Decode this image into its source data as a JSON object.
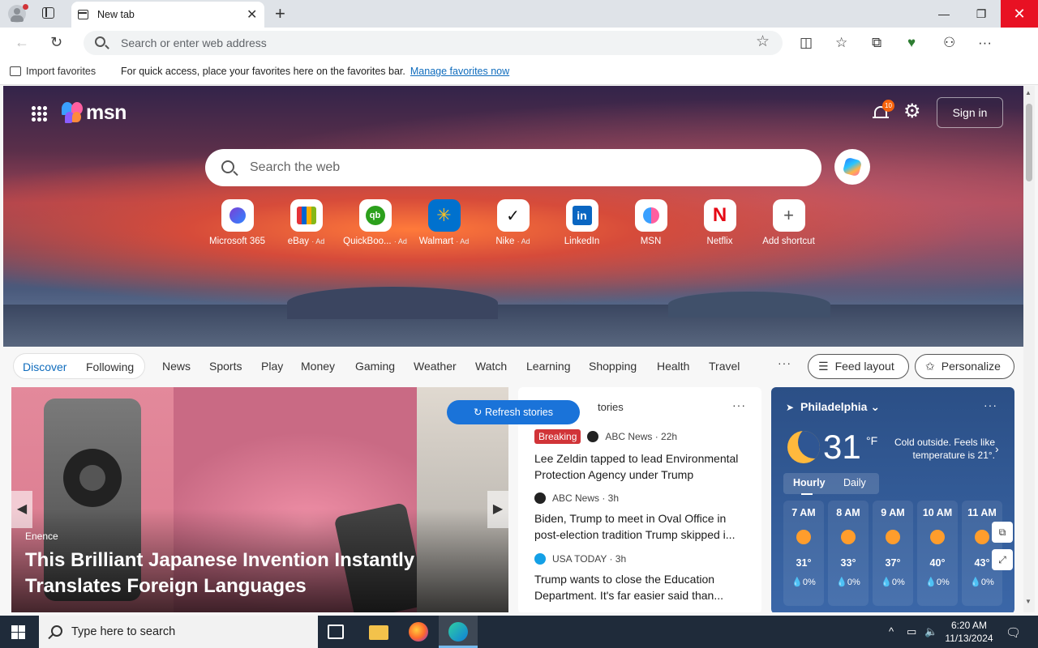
{
  "browser": {
    "tab_title": "New tab",
    "omnibox_placeholder": "Search or enter web address",
    "favbar": {
      "import_label": "Import favorites",
      "message": "For quick access, place your favorites here on the favorites bar.",
      "link": "Manage favorites now"
    }
  },
  "msn": {
    "logo": "msn",
    "notification_count": "10",
    "signin_label": "Sign in",
    "search_placeholder": "Search the web",
    "shortcuts": [
      {
        "label": "Microsoft 365",
        "ad": "",
        "icon": "m365-icon"
      },
      {
        "label": "eBay",
        "ad": "· Ad",
        "icon": "ebay-icon"
      },
      {
        "label": "QuickBoo...",
        "ad": "· Ad",
        "icon": "quickbooks-icon"
      },
      {
        "label": "Walmart",
        "ad": "· Ad",
        "icon": "walmart-icon"
      },
      {
        "label": "Nike",
        "ad": "· Ad",
        "icon": "nike-icon"
      },
      {
        "label": "LinkedIn",
        "ad": "",
        "icon": "linkedin-icon"
      },
      {
        "label": "MSN",
        "ad": "",
        "icon": "msn-icon"
      },
      {
        "label": "Netflix",
        "ad": "",
        "icon": "netflix-icon"
      },
      {
        "label": "Add shortcut",
        "ad": "",
        "icon": "plus-icon"
      }
    ],
    "nav": {
      "discover": "Discover",
      "following": "Following",
      "items": [
        "News",
        "Sports",
        "Play",
        "Money",
        "Gaming",
        "Weather",
        "Watch",
        "Learning",
        "Shopping",
        "Health",
        "Travel"
      ],
      "more": "···",
      "feed_layout": "Feed layout",
      "personalize": "Personalize"
    },
    "feature": {
      "source": "Enence",
      "headline": "This Brilliant Japanese Invention Instantly Translates Foreign Languages"
    },
    "refresh_label": "Refresh stories",
    "top_stories": {
      "title": "tories",
      "more": "···",
      "stories": [
        {
          "badge": "Breaking",
          "publisher": "ABC News · 22h",
          "headline": "Lee Zeldin tapped to lead Environmental Protection Agency under Trump"
        },
        {
          "badge": "",
          "publisher": "ABC News · 3h",
          "headline": "Biden, Trump to meet in Oval Office in post-election tradition Trump skipped i..."
        },
        {
          "badge": "",
          "publisher": "USA TODAY · 3h",
          "headline": "Trump wants to close the Education Department. It's far easier said than..."
        }
      ]
    },
    "weather": {
      "location": "Philadelphia",
      "temp": "31",
      "unit": "°F",
      "note": "Cold outside. Feels like temperature is 21°.",
      "tab_hourly": "Hourly",
      "tab_daily": "Daily",
      "hours": [
        {
          "time": "7 AM",
          "temp": "31°",
          "rain": "0%"
        },
        {
          "time": "8 AM",
          "temp": "33°",
          "rain": "0%"
        },
        {
          "time": "9 AM",
          "temp": "37°",
          "rain": "0%"
        },
        {
          "time": "10 AM",
          "temp": "40°",
          "rain": "0%"
        },
        {
          "time": "11 AM",
          "temp": "43°",
          "rain": "0%"
        }
      ]
    }
  },
  "taskbar": {
    "search_placeholder": "Type here to search",
    "time": "6:20 AM",
    "date": "11/13/2024"
  }
}
